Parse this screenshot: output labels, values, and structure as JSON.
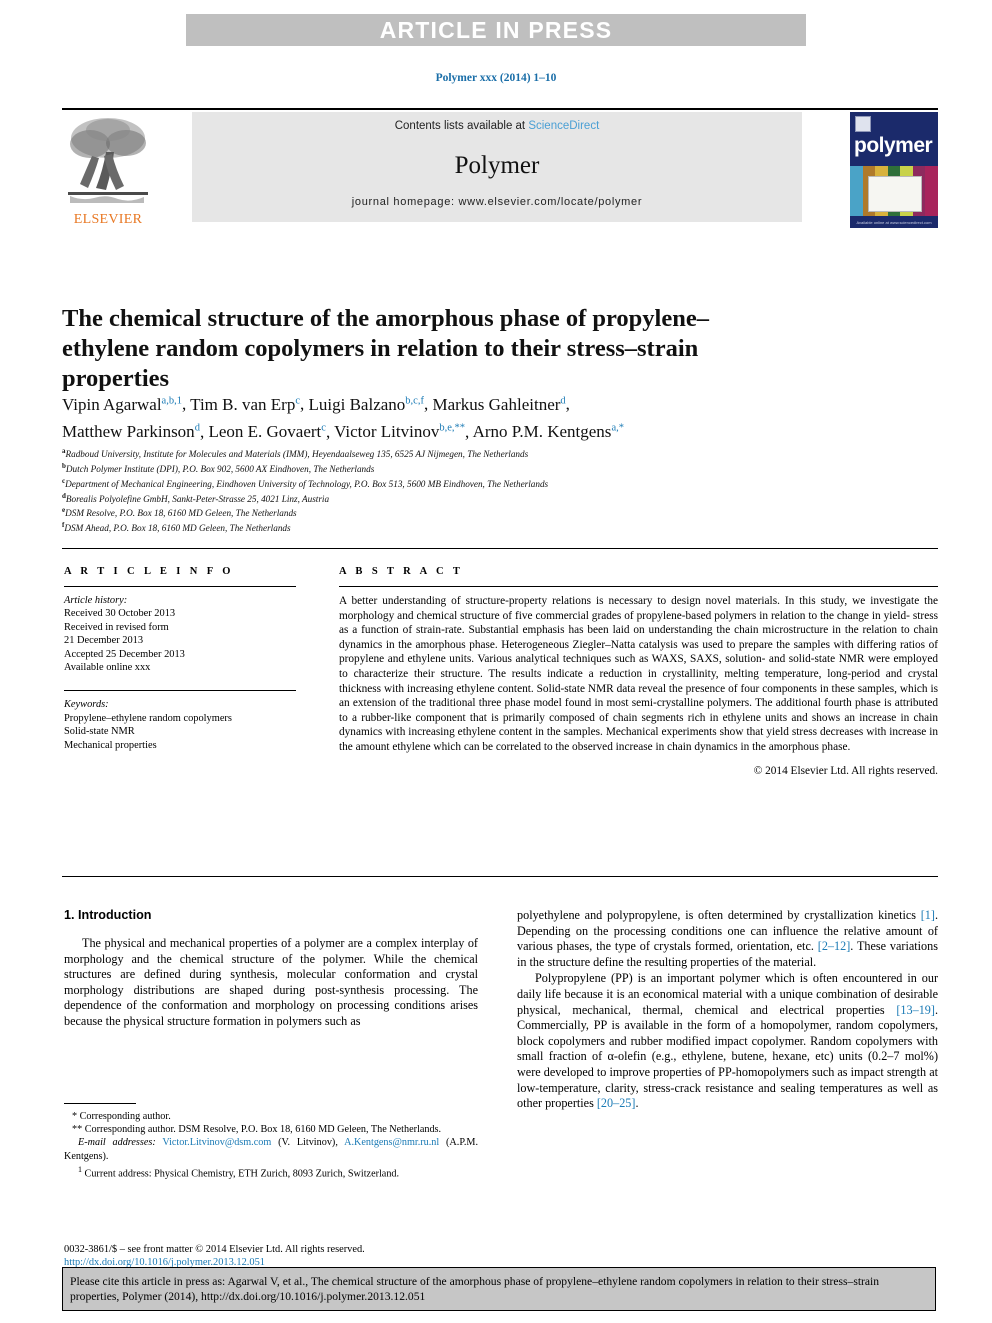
{
  "banner": {
    "text": "ARTICLE IN PRESS"
  },
  "journal_line": "Polymer xxx (2014) 1–10",
  "masthead": {
    "contents_prefix": "Contents lists available at ",
    "sciencedirect": "ScienceDirect",
    "journal_title": "Polymer",
    "homepage": "journal homepage: www.elsevier.com/locate/polymer",
    "publisher_logo_text": "ELSEVIER",
    "cover_title": "polymer",
    "cover_footer": "Available online at www.sciencedirect.com"
  },
  "article": {
    "title": "The chemical structure of the amorphous phase of propylene–ethylene random copolymers in relation to their stress–strain properties",
    "authors_line1": "Vipin Agarwal",
    "authors_line1_sup": "a,b,1",
    "authors": [
      {
        "name": "Vipin Agarwal",
        "sup": "a,b,1"
      },
      {
        "name": "Tim B. van Erp",
        "sup": "c"
      },
      {
        "name": "Luigi Balzano",
        "sup": "b,c,f"
      },
      {
        "name": "Markus Gahleitner",
        "sup": "d"
      },
      {
        "name": "Matthew Parkinson",
        "sup": "d"
      },
      {
        "name": "Leon E. Govaert",
        "sup": "c"
      },
      {
        "name": "Victor Litvinov",
        "sup": "b,e,**"
      },
      {
        "name": "Arno P.M. Kentgens",
        "sup": "a,*"
      }
    ],
    "affiliations": [
      {
        "sup": "a",
        "text": "Radboud University, Institute for Molecules and Materials (IMM), Heyendaalseweg 135, 6525 AJ Nijmegen, The Netherlands"
      },
      {
        "sup": "b",
        "text": "Dutch Polymer Institute (DPI), P.O. Box 902, 5600 AX Eindhoven, The Netherlands"
      },
      {
        "sup": "c",
        "text": "Department of Mechanical Engineering, Eindhoven University of Technology, P.O. Box 513, 5600 MB Eindhoven, The Netherlands"
      },
      {
        "sup": "d",
        "text": "Borealis Polyolefine GmbH, Sankt-Peter-Strasse 25, 4021 Linz, Austria"
      },
      {
        "sup": "e",
        "text": "DSM Resolve, P.O. Box 18, 6160 MD Geleen, The Netherlands"
      },
      {
        "sup": "f",
        "text": "DSM Ahead, P.O. Box 18, 6160 MD Geleen, The Netherlands"
      }
    ]
  },
  "article_info": {
    "heading": "A R T I C L E  I N F O",
    "history_label": "Article history:",
    "history": [
      "Received 30 October 2013",
      "Received in revised form",
      "21 December 2013",
      "Accepted 25 December 2013",
      "Available online xxx"
    ],
    "keywords_label": "Keywords:",
    "keywords": [
      "Propylene–ethylene random copolymers",
      "Solid-state NMR",
      "Mechanical properties"
    ]
  },
  "abstract": {
    "heading": "A B S T R A C T",
    "text": "A better understanding of structure-property relations is necessary to design novel materials. In this study, we investigate the morphology and chemical structure of five commercial grades of propylene-based polymers in relation to the change in yield- stress as a function of strain-rate. Substantial emphasis has been laid on understanding the chain microstructure in the relation to chain dynamics in the amorphous phase. Heterogeneous Ziegler–Natta catalysis was used to prepare the samples with differing ratios of propylene and ethylene units. Various analytical techniques such as WAXS, SAXS, solution- and solid-state NMR were employed to characterize their structure. The results indicate a reduction in crystallinity, melting temperature, long-period and crystal thickness with increasing ethylene content. Solid-state NMR data reveal the presence of four components in these samples, which is an extension of the traditional three phase model found in most semi-crystalline polymers. The additional fourth phase is attributed to a rubber-like component that is primarily composed of chain segments rich in ethylene units and shows an increase in chain dynamics with increasing ethylene content in the samples. Mechanical experiments show that yield stress decreases with increase in the amount ethylene which can be correlated to the observed increase in chain dynamics in the amorphous phase.",
    "copyright": "© 2014 Elsevier Ltd. All rights reserved."
  },
  "introduction": {
    "heading": "1. Introduction",
    "left_p1": "The physical and mechanical properties of a polymer are a complex interplay of morphology and the chemical structure of the polymer. While the chemical structures are defined during synthesis, molecular conformation and crystal morphology distributions are shaped during post-synthesis processing. The dependence of the conformation and morphology on processing conditions arises because the physical structure formation in polymers such as",
    "right_p1_a": "polyethylene and polypropylene, is often determined by crystallization kinetics ",
    "right_p1_ref1": "[1]",
    "right_p1_b": ". Depending on the processing conditions one can influence the relative amount of various phases, the type of crystals formed, orientation, etc. ",
    "right_p1_ref2": "[2–12]",
    "right_p1_c": ". These variations in the structure define the resulting properties of the material.",
    "right_p2_a": "Polypropylene (PP) is an important polymer which is often encountered in our daily life because it is an economical material with a unique combination of desirable physical, mechanical, thermal, chemical and electrical properties ",
    "right_p2_ref1": "[13–19]",
    "right_p2_b": ". Commercially, PP is available in the form of a homopolymer, random copolymers, block copolymers and rubber modified impact copolymer. Random copolymers with small fraction of α-olefin (e.g., ethylene, butene, hexane, etc) units (0.2–7 mol%) were developed to improve properties of PP-homopolymers such as impact strength at low-temperature, clarity, stress-crack resistance and sealing temperatures as well as other properties ",
    "right_p2_ref2": "[20–25]",
    "right_p2_c": "."
  },
  "footnotes": {
    "corr1": "* Corresponding author.",
    "corr2": "** Corresponding author. DSM Resolve, P.O. Box 18, 6160 MD Geleen, The Netherlands.",
    "email_label": "E-mail addresses:",
    "email1": "Victor.Litvinov@dsm.com",
    "email1_who": "(V. Litvinov),",
    "email2": "A.Kentgens@nmr.ru.nl",
    "email2_who": "(A.P.M. Kentgens).",
    "current_address_sup": "1",
    "current_address": "Current address: Physical Chemistry, ETH Zurich, 8093 Zurich, Switzerland.",
    "issn_line": "0032-3861/$ – see front matter © 2014 Elsevier Ltd. All rights reserved.",
    "doi_line": "http://dx.doi.org/10.1016/j.polymer.2013.12.051"
  },
  "citation_box": {
    "text": "Please cite this article in press as: Agarwal V, et al., The chemical structure of the amorphous phase of propylene–ethylene random copolymers in relation to their stress–strain properties, Polymer (2014), http://dx.doi.org/10.1016/j.polymer.2013.12.051"
  },
  "colors": {
    "banner_bg": "#bfbfbf",
    "link_blue": "#1a7ab5",
    "sciencedirect_blue": "#4a9fd4",
    "elsevier_orange": "#e87722",
    "cover_navy": "#1b2a6b",
    "panel_gray": "#e6e6e6",
    "cite_gray": "#c6c6c6"
  }
}
